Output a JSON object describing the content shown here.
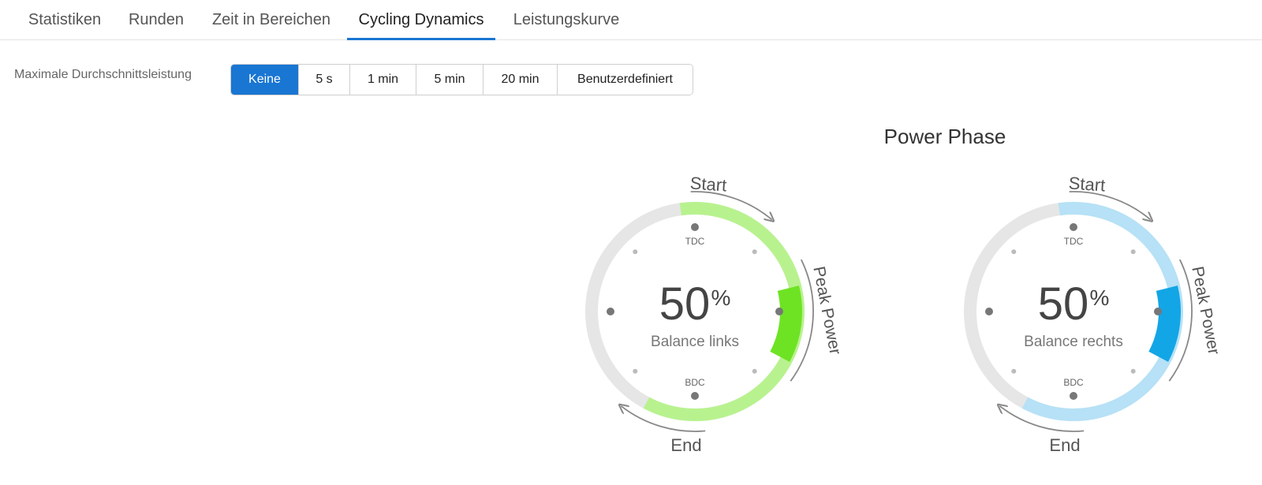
{
  "tabs": [
    {
      "label": "Statistiken"
    },
    {
      "label": "Runden"
    },
    {
      "label": "Zeit in Bereichen"
    },
    {
      "label": "Cycling Dynamics"
    },
    {
      "label": "Leistungskurve"
    }
  ],
  "active_tab": "Cycling Dynamics",
  "filter": {
    "label": "Maximale Durchschnittsleistung",
    "options": [
      {
        "label": "Keine"
      },
      {
        "label": "5 s"
      },
      {
        "label": "1 min"
      },
      {
        "label": "5 min"
      },
      {
        "label": "20 min"
      },
      {
        "label": "Benutzerdefiniert"
      }
    ],
    "selected": "Keine"
  },
  "power_phase": {
    "title": "Power Phase",
    "gauges": [
      {
        "value": "50",
        "unit": "%",
        "caption": "Balance links",
        "tdc": "TDC",
        "bdc": "BDC",
        "start_label": "Start",
        "end_label": "End",
        "peak_label": "Peak Power",
        "light_color": "#b8f28f",
        "dark_color": "#6ee324"
      },
      {
        "value": "50",
        "unit": "%",
        "caption": "Balance rechts",
        "tdc": "TDC",
        "bdc": "BDC",
        "start_label": "Start",
        "end_label": "End",
        "peak_label": "Peak Power",
        "light_color": "#b6e1f6",
        "dark_color": "#12a6e6"
      }
    ]
  },
  "colors": {
    "accent": "#1976d2",
    "track": "#e6e6e6",
    "arrow": "#888888",
    "dot": "#777777"
  }
}
